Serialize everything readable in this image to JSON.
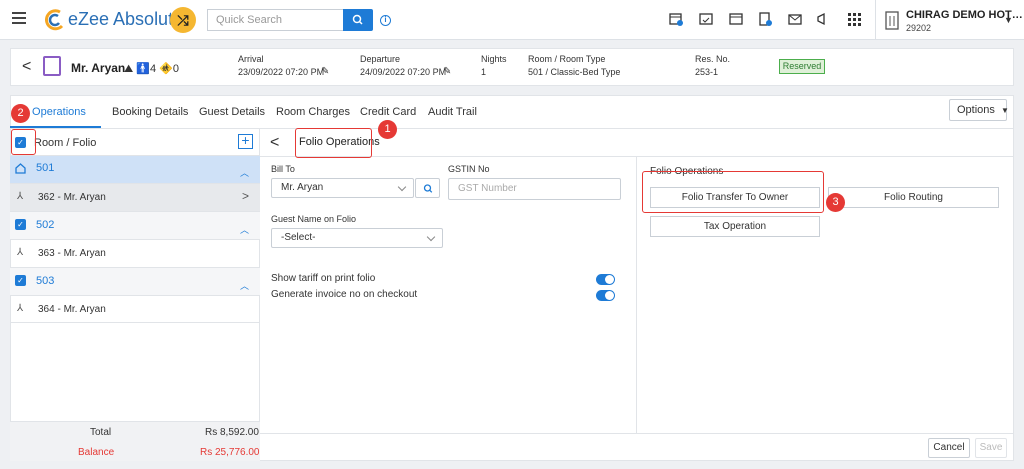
{
  "topbar": {
    "app_name": "eZee Absolute",
    "search_placeholder": "Quick Search",
    "property_name": "CHIRAG DEMO HOT…",
    "property_code": "29202",
    "brand_color": "#2a6fb5",
    "icons": [
      "calendar-clock-icon",
      "calendar-check-icon",
      "calendar-icon",
      "calculator-doc-icon",
      "mail-icon",
      "megaphone-icon",
      "apps-grid-icon",
      "building-icon"
    ]
  },
  "reservation": {
    "guest_name": "Mr. Aryan",
    "pax_adults": "4",
    "pax_children": "0",
    "arrival_label": "Arrival",
    "arrival_value": "23/09/2022 07:20 PM",
    "departure_label": "Departure",
    "departure_value": "24/09/2022 07:20 PM",
    "nights_label": "Nights",
    "nights_value": "1",
    "room_label": "Room / Room Type",
    "room_value": "501 / Classic-Bed Type",
    "resno_label": "Res. No.",
    "resno_value": "253-1",
    "status": "Reserved"
  },
  "tabs": [
    {
      "label": "lio Operations",
      "active": true
    },
    {
      "label": "Booking Details"
    },
    {
      "label": "Guest Details"
    },
    {
      "label": "Room Charges"
    },
    {
      "label": "Credit Card"
    },
    {
      "label": "Audit Trail"
    }
  ],
  "options_label": "Options",
  "left_pane": {
    "header_label": "Room / Folio",
    "rooms": [
      {
        "room": "501",
        "folio": "362 - Mr. Aryan"
      },
      {
        "room": "502",
        "folio": "363 - Mr. Aryan"
      },
      {
        "room": "503",
        "folio": "364 - Mr. Aryan"
      }
    ],
    "total_label": "Total",
    "total_value": "Rs 8,592.00",
    "balance_label": "Balance",
    "balance_value": "Rs 25,776.00"
  },
  "folio_ops": {
    "title": "Folio Operations",
    "bill_to_label": "Bill To",
    "bill_to_value": "Mr. Aryan",
    "gstin_label": "GSTIN No",
    "gstin_placeholder": "GST Number",
    "guest_name_label": "Guest Name on Folio",
    "guest_name_value": "-Select-",
    "toggle1_label": "Show tariff on print folio",
    "toggle2_label": "Generate invoice no on checkout",
    "section_label": "Folio Operations",
    "btn_transfer": "Folio Transfer To Owner",
    "btn_routing": "Folio Routing",
    "btn_tax": "Tax Operation"
  },
  "footer": {
    "cancel": "Cancel",
    "save": "Save"
  },
  "callouts": [
    "1",
    "2",
    "3"
  ]
}
